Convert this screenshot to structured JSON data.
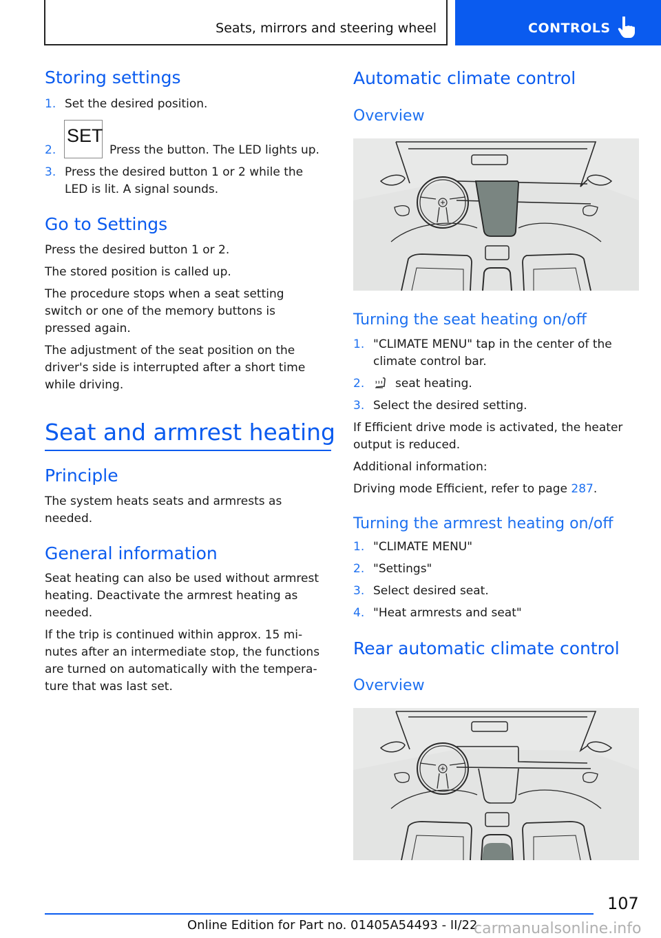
{
  "header": {
    "chapter_title": "Seats, mirrors and steering wheel",
    "section_tab": "CONTROLS",
    "section_icon": "pointing-hand-icon"
  },
  "left": {
    "storing": {
      "title": "Storing settings",
      "steps": [
        {
          "num": "1.",
          "text": "Set the desired position."
        },
        {
          "num": "2.",
          "button": "SET",
          "text": "Press the button. The LED lights up."
        },
        {
          "num": "3.",
          "text": "Press the desired button 1 or 2 while the LED is lit. A signal sounds."
        }
      ]
    },
    "goto": {
      "title": "Go to Settings",
      "paragraphs": [
        "Press the desired button 1 or 2.",
        "The stored position is called up.",
        "The procedure stops when a seat setting switch or one of the memory buttons is pressed again.",
        "The adjustment of the seat position on the driver's side is interrupted after a short time while driving."
      ]
    },
    "seat_heating": {
      "title": "Seat and armrest heating",
      "principle": {
        "title": "Principle",
        "text": "The system heats seats and armrests as needed."
      },
      "general": {
        "title": "General information",
        "paragraphs": [
          "Seat heating can also be used without armrest heating. Deactivate the armrest heating as needed.",
          "If the trip is continued within approx. 15 mi-nutes after an intermediate stop, the functions are turned on automatically with the tempera-ture that was last set."
        ]
      }
    }
  },
  "right": {
    "auto_climate": {
      "title": "Automatic climate control",
      "overview_title": "Overview",
      "illustration": "car-interior-front-display-highlighted"
    },
    "seat_heat_onoff": {
      "title": "Turning the seat heating on/off",
      "steps": [
        {
          "num": "1.",
          "text": "\"CLIMATE MENU\" tap in the center of the climate control bar."
        },
        {
          "num": "2.",
          "icon": "seat-heating-icon",
          "text": "seat heating."
        },
        {
          "num": "3.",
          "text": "Select the desired setting."
        }
      ],
      "note": "If Efficient drive mode is activated, the heater output is reduced.",
      "additional_label": "Additional information:",
      "ref_text": "Driving mode Efficient, refer to page ",
      "ref_page": "287",
      "ref_end": "."
    },
    "armrest_onoff": {
      "title": "Turning the armrest heating on/off",
      "steps": [
        {
          "num": "1.",
          "text": "\"CLIMATE MENU\""
        },
        {
          "num": "2.",
          "text": "\"Settings\""
        },
        {
          "num": "3.",
          "text": "Select desired seat."
        },
        {
          "num": "4.",
          "text": "\"Heat armrests and seat\""
        }
      ]
    },
    "rear_climate": {
      "title": "Rear automatic climate control",
      "overview_title": "Overview",
      "illustration": "car-interior-rear-console-highlighted"
    }
  },
  "footer": {
    "page_number": "107",
    "edition": "Online Edition for Part no. 01405A54493 - II/22",
    "watermark": "carmanualsonline.info"
  },
  "colors": {
    "accent": "#0a5bef",
    "heading": "#1d70f0",
    "illustration_bg": "#e8e9e8",
    "highlight": "#7a8581"
  }
}
